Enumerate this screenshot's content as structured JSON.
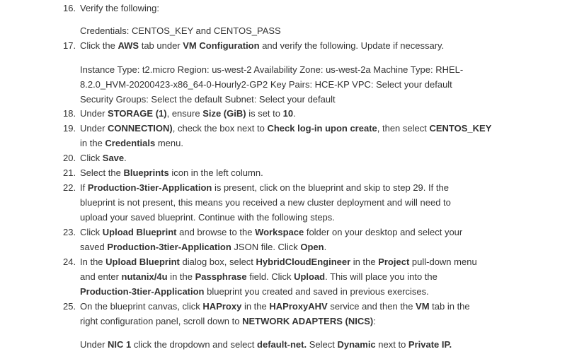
{
  "steps": [
    {
      "num": "16.",
      "parts": [
        {
          "t": "Verify the following:"
        }
      ]
    },
    {
      "num": "17.",
      "parts": [
        {
          "t": "Click the "
        },
        {
          "b": "AWS"
        },
        {
          "t": " tab under "
        },
        {
          "b": "VM Configuration"
        },
        {
          "t": " and verify the following. Update if necessary."
        }
      ]
    },
    {
      "num": "18.",
      "parts": [
        {
          "t": "Under "
        },
        {
          "b": "STORAGE (1)"
        },
        {
          "t": ", ensure "
        },
        {
          "b": "Size (GiB)"
        },
        {
          "t": " is set to "
        },
        {
          "b": "10"
        },
        {
          "t": "."
        }
      ]
    },
    {
      "num": "19.",
      "parts": [
        {
          "t": "Under "
        },
        {
          "b": "CONNECTION)"
        },
        {
          "t": ", check the box next to "
        },
        {
          "b": "Check log-in upon create"
        },
        {
          "t": ", then select "
        },
        {
          "b": "CENTOS_KEY"
        },
        {
          "t": " in the "
        },
        {
          "b": "Credentials"
        },
        {
          "t": " menu."
        }
      ]
    },
    {
      "num": "20.",
      "parts": [
        {
          "t": "Click "
        },
        {
          "b": "Save"
        },
        {
          "t": "."
        }
      ]
    },
    {
      "num": "21.",
      "parts": [
        {
          "t": "Select the "
        },
        {
          "b": "Blueprints"
        },
        {
          "t": " icon in the left column."
        }
      ]
    },
    {
      "num": "22.",
      "parts": [
        {
          "t": "If "
        },
        {
          "b": "Production-3tier-Application"
        },
        {
          "t": " is present, click on the blueprint and skip to step 29. If the blueprint is not present, this means you received a new cluster deployment and will need to upload your saved blueprint. Continue with the following steps."
        }
      ]
    },
    {
      "num": "23.",
      "parts": [
        {
          "t": "Click "
        },
        {
          "b": "Upload Blueprint"
        },
        {
          "t": " and browse to the "
        },
        {
          "b": "Workspace"
        },
        {
          "t": " folder on your desktop and select your saved "
        },
        {
          "b": "Production-3tier-Application"
        },
        {
          "t": " JSON file. Click "
        },
        {
          "b": "Open"
        },
        {
          "t": "."
        }
      ]
    },
    {
      "num": "24.",
      "parts": [
        {
          "t": "In the "
        },
        {
          "b": "Upload Blueprint"
        },
        {
          "t": " dialog box, select "
        },
        {
          "b": "HybridCloudEngineer"
        },
        {
          "t": " in the "
        },
        {
          "b": "Project"
        },
        {
          "t": " pull-down menu and enter "
        },
        {
          "b": "nutanix/4u"
        },
        {
          "t": " in the "
        },
        {
          "b": "Passphrase"
        },
        {
          "t": " field. Click "
        },
        {
          "b": "Upload"
        },
        {
          "t": ". This will place you into the "
        },
        {
          "b": "Production-3tier-Application"
        },
        {
          "t": " blueprint you created and saved in previous exercises."
        }
      ]
    },
    {
      "num": "25.",
      "parts": [
        {
          "t": "On the blueprint canvas, click "
        },
        {
          "b": "HAProxy"
        },
        {
          "t": " in the "
        },
        {
          "b": "HAProxyAHV"
        },
        {
          "t": " service and then the "
        },
        {
          "b": "VM"
        },
        {
          "t": " tab in the right configuration panel, scroll down to "
        },
        {
          "b": "NETWORK ADAPTERS (NICS)"
        },
        {
          "t": ":"
        }
      ]
    }
  ],
  "subs": [
    {
      "parts": [
        {
          "t": "Credentials: CENTOS_KEY and CENTOS_PASS"
        }
      ]
    },
    {
      "parts": [
        {
          "t": "Instance Type: t2.micro Region: us-west-2 Availability Zone: us-west-2a Machine Type: RHEL-8.2.0_HVM-20200423-x86_64-0-Hourly2-GP2 Key Pairs: HCE-KP VPC: Select your default Security Groups: Select the default Subnet: Select your default"
        }
      ]
    },
    {
      "parts": [
        {
          "t": "Under "
        },
        {
          "b": "NIC 1"
        },
        {
          "t": " click the dropdown and select "
        },
        {
          "b": "default-net."
        },
        {
          "t": " Select "
        },
        {
          "b": "Dynamic"
        },
        {
          "t": " next to "
        },
        {
          "b": "Private IP."
        }
      ]
    }
  ]
}
